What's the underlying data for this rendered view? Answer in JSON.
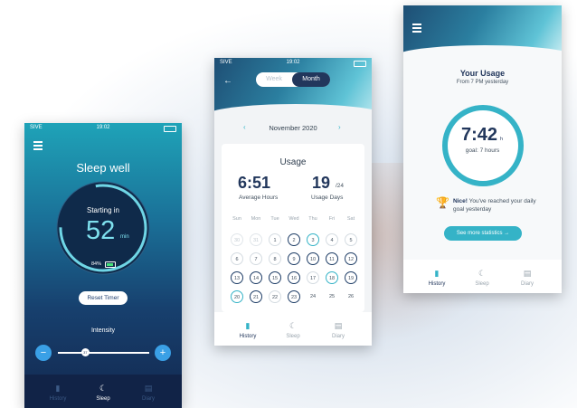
{
  "status": {
    "carrier": "SIVE",
    "time": "19:02"
  },
  "sleep_screen": {
    "title": "Sleep well",
    "starting_label": "Starting in",
    "minutes": "52",
    "minutes_unit": "min",
    "battery": "84%",
    "reset_label": "Reset Timer",
    "intensity_label": "Intensity",
    "minus": "−",
    "plus": "+",
    "slider_value": "37",
    "slider_position": 0.3,
    "tabs": [
      {
        "label": "History",
        "icon": "bar-chart-icon"
      },
      {
        "label": "Sleep",
        "icon": "moon-icon"
      },
      {
        "label": "Diary",
        "icon": "document-icon"
      }
    ],
    "active_tab": "Sleep"
  },
  "month_screen": {
    "toggle": {
      "week": "Week",
      "month": "Month",
      "selected": "Month"
    },
    "month_label": "November 2020",
    "prev": "‹",
    "next": "›",
    "usage_title": "Usage",
    "avg_hours": "6:51",
    "avg_label": "Average Hours",
    "usage_days": "19",
    "usage_days_total": "/24",
    "usage_days_label": "Usage Days",
    "weekdays": [
      "Sun",
      "Mon",
      "Tue",
      "Wed",
      "Thu",
      "Fri",
      "Sat"
    ],
    "calendar": [
      [
        "",
        "",
        "",
        "1",
        "2",
        "3",
        "4",
        "5"
      ],
      [
        "6",
        "7",
        "8",
        "9",
        "10",
        "11",
        "12"
      ],
      [
        "13",
        "14",
        "15",
        "16",
        "17",
        "18",
        "19"
      ],
      [
        "20",
        "21",
        "22",
        "23",
        "24",
        "25",
        "26"
      ]
    ],
    "week1": [
      "30",
      "31",
      "1",
      "2",
      "3",
      "4",
      "5"
    ],
    "tabs": [
      {
        "label": "History",
        "icon": "bar-chart-icon"
      },
      {
        "label": "Sleep",
        "icon": "moon-icon"
      },
      {
        "label": "Diary",
        "icon": "document-icon"
      }
    ],
    "active_tab": "History"
  },
  "usage_screen": {
    "title": "Your Usage",
    "subtitle": "From 7 PM yesterday",
    "hours": "7:42",
    "hours_unit": "h",
    "goal": "goal: 7 hours",
    "nice_bold": "Nice!",
    "nice_text": " You've reached your daily goal yesterday",
    "more_button": "See more statistics →",
    "tabs": [
      {
        "label": "History",
        "icon": "bar-chart-icon"
      },
      {
        "label": "Sleep",
        "icon": "moon-icon"
      },
      {
        "label": "Diary",
        "icon": "document-icon"
      }
    ],
    "active_tab": "History"
  },
  "colors": {
    "accent": "#35b3c7",
    "navy": "#22375c",
    "blue_button": "#3aa0e6"
  }
}
